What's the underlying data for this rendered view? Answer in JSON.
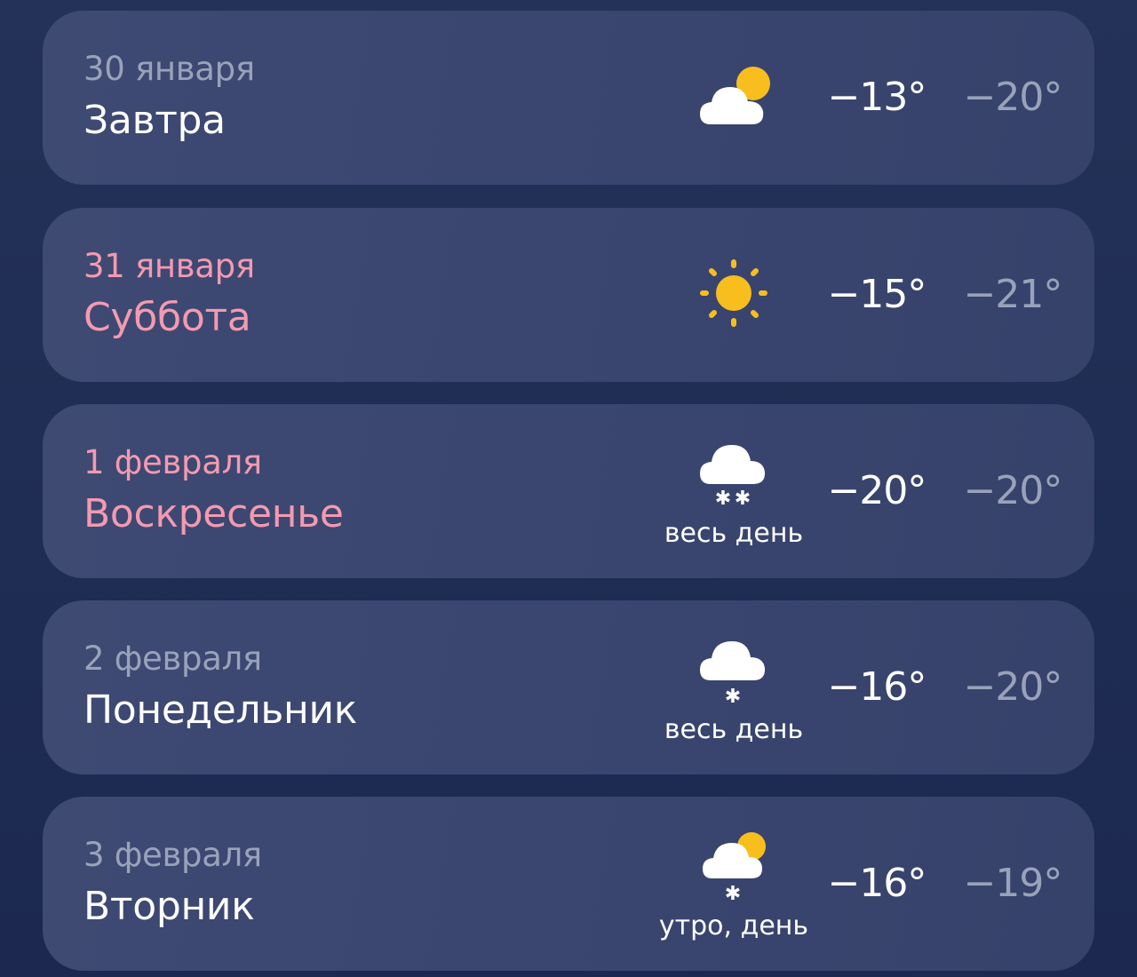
{
  "days": [
    {
      "date": "30 января",
      "weekday": "Завтра",
      "weather": "partly-cloudy-icon",
      "precip": "",
      "temp_day": "−13°",
      "temp_night": "−20°"
    },
    {
      "date": "31 января",
      "weekday": "Суббота",
      "weather": "sun-icon",
      "precip": "",
      "temp_day": "−15°",
      "temp_night": "−21°"
    },
    {
      "date": "1 февраля",
      "weekday": "Воскресенье",
      "weather": "cloud-snow-icon",
      "precip": "весь день",
      "temp_day": "−20°",
      "temp_night": "−20°"
    },
    {
      "date": "2 февраля",
      "weekday": "Понедельник",
      "weather": "cloud-light-snow-icon",
      "precip": "весь день",
      "temp_day": "−16°",
      "temp_night": "−20°"
    },
    {
      "date": "3 февраля",
      "weekday": "Вторник",
      "weather": "partly-cloudy-snow-icon",
      "precip": "утро, день",
      "temp_day": "−16°",
      "temp_night": "−19°"
    }
  ],
  "colors": {
    "weekend": "#f49ab0",
    "secondary_text": "#9aa2bb",
    "sun": "#f8be1e",
    "cloud": "#ffffff"
  }
}
